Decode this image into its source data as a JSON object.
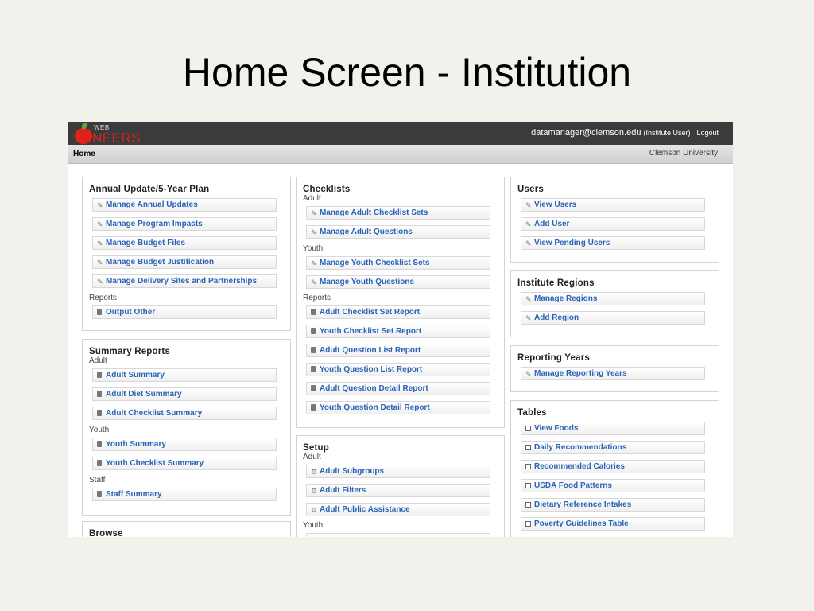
{
  "slide_title": "Home Screen - Institution",
  "header": {
    "logo_small": "WEB",
    "logo_big": "NEERS",
    "user_email": "datamanager@clemson.edu",
    "user_role": "(Institute User)",
    "logout": "Logout"
  },
  "nav": {
    "home": "Home",
    "institution": "Clemson University"
  },
  "annual": {
    "title": "Annual Update/5-Year Plan",
    "items": [
      "Manage Annual Updates",
      "Manage Program Impacts",
      "Manage Budget Files",
      "Manage Budget Justification",
      "Manage Delivery Sites and Partnerships"
    ],
    "reports_label": "Reports",
    "reports": [
      "Output Other"
    ]
  },
  "summary": {
    "title": "Summary Reports",
    "adult_label": "Adult",
    "adult": [
      "Adult Summary",
      "Adult Diet Summary",
      "Adult Checklist Summary"
    ],
    "youth_label": "Youth",
    "youth": [
      "Youth Summary",
      "Youth Checklist Summary"
    ],
    "staff_label": "Staff",
    "staff": [
      "Staff Summary"
    ]
  },
  "browse": {
    "title": "Browse"
  },
  "checklists": {
    "title": "Checklists",
    "adult_label": "Adult",
    "adult": [
      "Manage Adult Checklist Sets",
      "Manage Adult Questions"
    ],
    "youth_label": "Youth",
    "youth": [
      "Manage Youth Checklist Sets",
      "Manage Youth Questions"
    ],
    "reports_label": "Reports",
    "reports": [
      "Adult Checklist Set Report",
      "Youth Checklist Set Report",
      "Adult Question List Report",
      "Youth Question List Report",
      "Adult Question Detail Report",
      "Youth Question Detail Report"
    ]
  },
  "setup": {
    "title": "Setup",
    "adult_label": "Adult",
    "adult": [
      "Adult Subgroups",
      "Adult Filters",
      "Adult Public Assistance"
    ],
    "youth_label": "Youth"
  },
  "users": {
    "title": "Users",
    "items": [
      "View Users",
      "Add User",
      "View Pending Users"
    ]
  },
  "regions": {
    "title": "Institute Regions",
    "items": [
      "Manage Regions",
      "Add Region"
    ]
  },
  "years": {
    "title": "Reporting Years",
    "items": [
      "Manage Reporting Years"
    ]
  },
  "tables": {
    "title": "Tables",
    "items": [
      "View Foods",
      "Daily Recommendations",
      "Recommended Calories",
      "USDA Food Patterns",
      "Dietary Reference Intakes",
      "Poverty Guidelines Table"
    ]
  }
}
